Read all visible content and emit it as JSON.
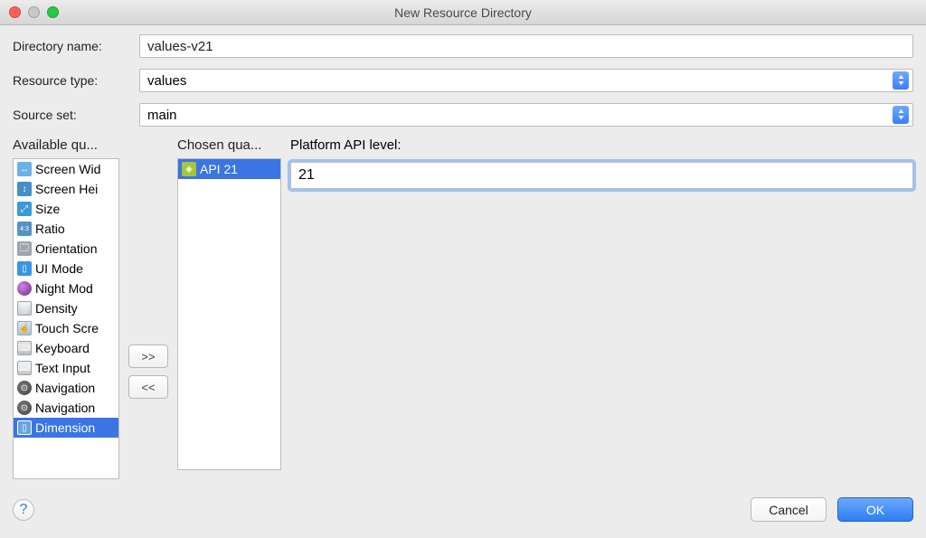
{
  "window": {
    "title": "New Resource Directory"
  },
  "labels": {
    "directory_name": "Directory name:",
    "resource_type": "Resource type:",
    "source_set": "Source set:",
    "available": "Available qu...",
    "chosen": "Chosen qua...",
    "api_level": "Platform API level:"
  },
  "fields": {
    "directory_name_value": "values-v21",
    "resource_type_value": "values",
    "source_set_value": "main",
    "api_level_value": "21"
  },
  "shuttle": {
    "add": ">>",
    "remove": "<<"
  },
  "available_items": [
    "Screen Wid",
    "Screen Hei",
    "Size",
    "Ratio",
    "Orientation",
    "UI Mode",
    "Night Mod",
    "Density",
    "Touch Scre",
    "Keyboard",
    "Text Input",
    "Navigation",
    "Navigation",
    "Dimension"
  ],
  "chosen_items": [
    "API 21"
  ],
  "footer": {
    "help": "?",
    "cancel": "Cancel",
    "ok": "OK"
  }
}
